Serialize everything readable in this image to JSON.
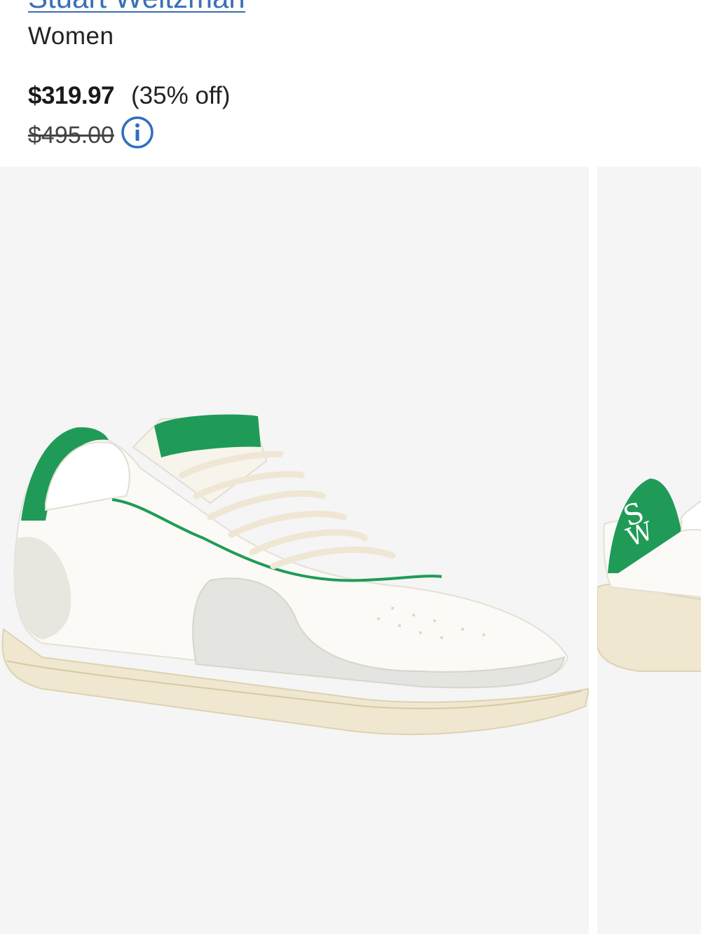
{
  "product": {
    "brand": "Stuart Weitzman",
    "category": "Women",
    "sale_price": "$319.97",
    "discount": "(35% off)",
    "original_price": "$495.00"
  },
  "icons": {
    "info": "info-circle-icon"
  },
  "colors": {
    "link": "#3a6fb5",
    "accent_green": "#1f9b57",
    "image_background": "#f5f5f5"
  },
  "gallery": {
    "slides": [
      {
        "image": "sneaker-side-view"
      },
      {
        "image": "sneaker-heel-view"
      }
    ]
  }
}
